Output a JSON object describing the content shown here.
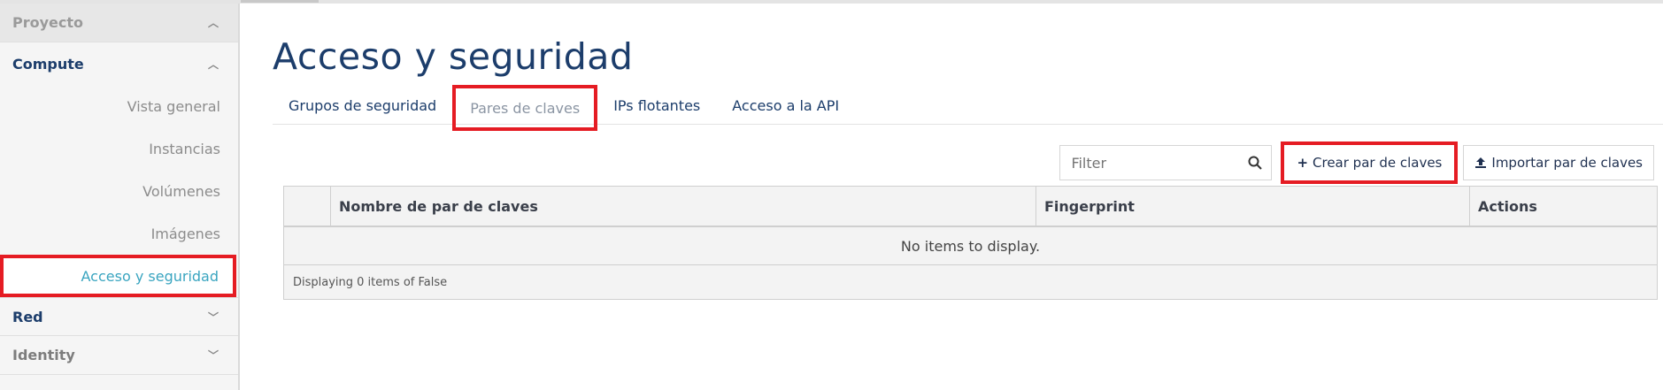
{
  "sidebar": {
    "project": "Proyecto",
    "compute": "Compute",
    "items": [
      "Vista general",
      "Instancias",
      "Volúmenes",
      "Imágenes",
      "Acceso y seguridad"
    ],
    "red": "Red",
    "identity": "Identity"
  },
  "page": {
    "title": "Acceso y seguridad"
  },
  "tabs": [
    "Grupos de seguridad",
    "Pares de claves",
    "IPs flotantes",
    "Acceso a la API"
  ],
  "toolbar": {
    "filter_placeholder": "Filter",
    "create_label": "Crear par de claves",
    "import_label": "Importar par de claves"
  },
  "table": {
    "columns": [
      "Nombre de par de claves",
      "Fingerprint",
      "Actions"
    ],
    "empty_message": "No items to display.",
    "footer": "Displaying 0 items of False"
  },
  "colors": {
    "highlight": "#e51c23",
    "active_link": "#3aa5c0",
    "title": "#1c3d6b"
  }
}
